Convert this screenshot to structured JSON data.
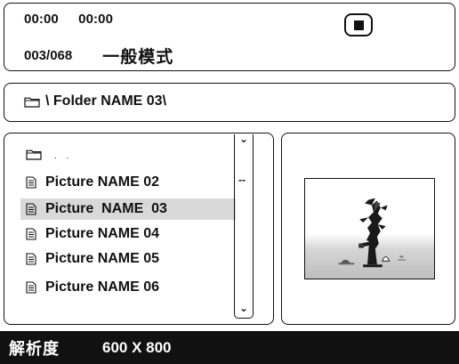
{
  "status": {
    "elapsed_time": "00:00",
    "total_time": "00:00",
    "track_counter": "003/068",
    "mode_label": "一般模式",
    "stop_icon": "stop-icon"
  },
  "path": {
    "icon": "folder-icon",
    "text": "\\ Folder NAME 03\\"
  },
  "file_list": {
    "parent": {
      "icon": "folder-icon",
      "label": ". ."
    },
    "items": [
      {
        "icon": "document-icon",
        "label": "Picture NAME 02",
        "selected": false
      },
      {
        "icon": "document-icon",
        "label": "Picture  NAME  03",
        "selected": true
      },
      {
        "icon": "document-icon",
        "label": "Picture NAME 04",
        "selected": false
      },
      {
        "icon": "document-icon",
        "label": "Picture NAME 05",
        "selected": false
      },
      {
        "icon": "document-icon",
        "label": "Picture NAME 06",
        "selected": false
      }
    ],
    "scroll_glyphs": {
      "top": "⌄",
      "middle": "--",
      "bottom": "⌄"
    }
  },
  "resolution": {
    "label": "解析度",
    "value": "600 X 800"
  },
  "colors": {
    "foreground": "#111111",
    "background": "#ffffff",
    "selection": "#d9d9d9"
  }
}
